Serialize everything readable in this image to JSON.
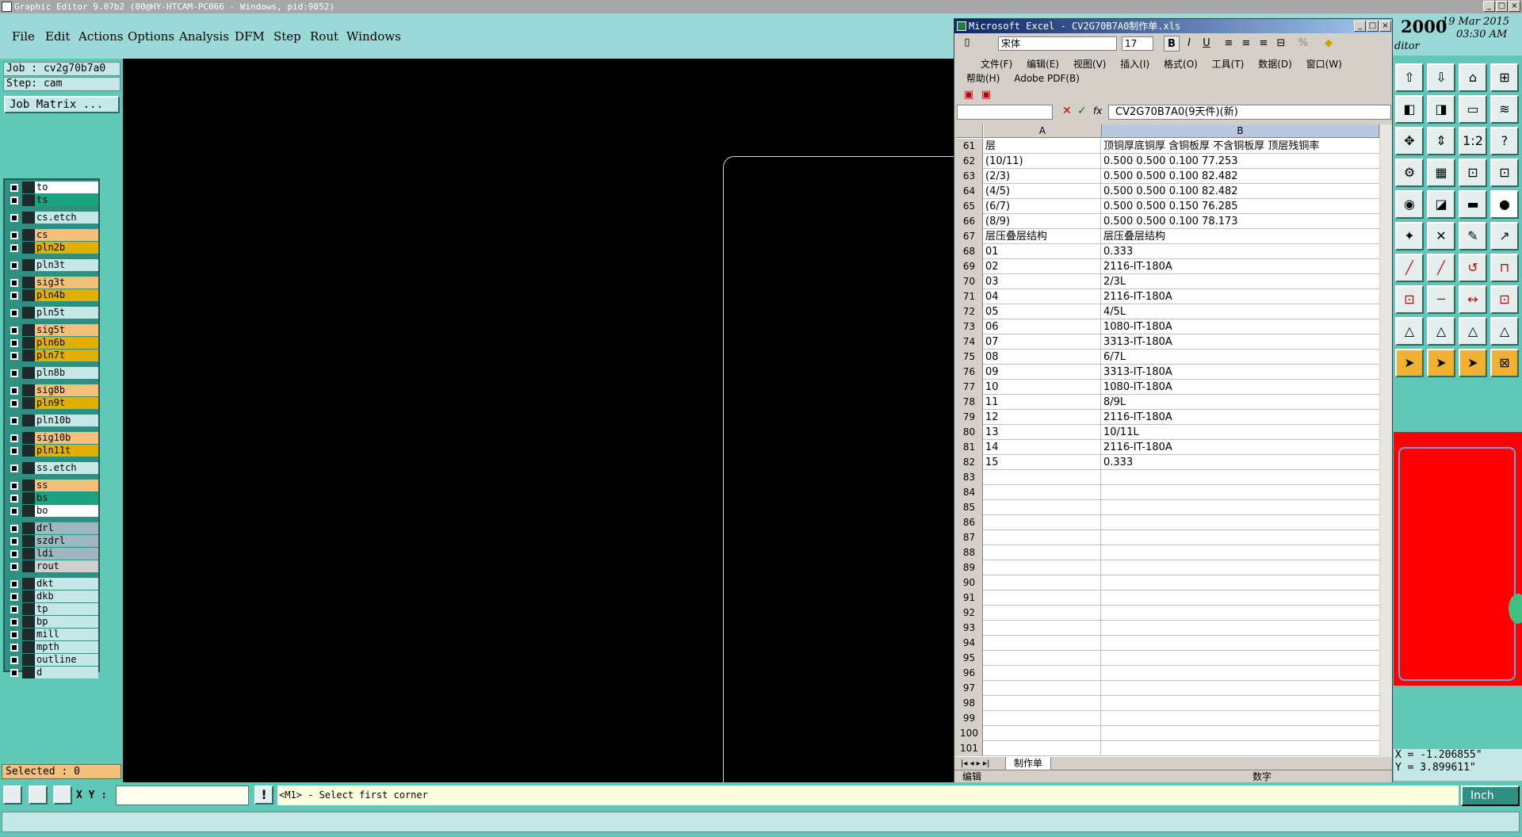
{
  "window": {
    "title": "Graphic Editor 9.07b2 (00@HY-HTCAM-PC066 - Windows, pid:9852)"
  },
  "menu": [
    "File",
    "Edit",
    "Actions",
    "Options",
    "Analysis",
    "DFM",
    "Step",
    "Rout",
    "Windows"
  ],
  "job": {
    "job": "Job : cv2g70b7a0",
    "step": "Step: cam",
    "matrix_button": "Job Matrix ..."
  },
  "layers": [
    {
      "name": "to",
      "color": "#ffffff"
    },
    {
      "name": "ts",
      "color": "#1aa37f"
    },
    {
      "name": "cs.etch",
      "color": "#c4e8e8"
    },
    {
      "name": "cs",
      "color": "#f5c07a"
    },
    {
      "name": "pln2b",
      "color": "#e0b000"
    },
    {
      "name": "pln3t",
      "color": "#c4e8e8"
    },
    {
      "name": "sig3t",
      "color": "#f5c07a"
    },
    {
      "name": "pln4b",
      "color": "#e0b000"
    },
    {
      "name": "pln5t",
      "color": "#c4e8e8"
    },
    {
      "name": "sig5t",
      "color": "#f5c07a"
    },
    {
      "name": "pln6b",
      "color": "#e0b000"
    },
    {
      "name": "pln7t",
      "color": "#e0b000"
    },
    {
      "name": "pln8b",
      "color": "#c4e8e8"
    },
    {
      "name": "sig8b",
      "color": "#f5c07a"
    },
    {
      "name": "pln9t",
      "color": "#e0b000"
    },
    {
      "name": "pln10b",
      "color": "#c4e8e8"
    },
    {
      "name": "sig10b",
      "color": "#f5c07a"
    },
    {
      "name": "pln11t",
      "color": "#e0b000"
    },
    {
      "name": "ss.etch",
      "color": "#c4e8e8"
    },
    {
      "name": "ss",
      "color": "#f5c07a"
    },
    {
      "name": "bs",
      "color": "#1aa37f"
    },
    {
      "name": "bo",
      "color": "#ffffff"
    },
    {
      "name": "drl",
      "color": "#9fb8c0"
    },
    {
      "name": "szdrl",
      "color": "#9fb8c0"
    },
    {
      "name": "ldi",
      "color": "#9fb8c0"
    },
    {
      "name": "rout",
      "color": "#d0d0d0"
    },
    {
      "name": "dkt",
      "color": "#c4e8e8"
    },
    {
      "name": "dkb",
      "color": "#c4e8e8"
    },
    {
      "name": "tp",
      "color": "#c4e8e8"
    },
    {
      "name": "bp",
      "color": "#c4e8e8"
    },
    {
      "name": "mill",
      "color": "#c4e8e8"
    },
    {
      "name": "mpth",
      "color": "#c4e8e8"
    },
    {
      "name": "outline",
      "color": "#c4e8e8"
    },
    {
      "name": "d",
      "color": "#c4e8e8"
    }
  ],
  "selected": "Selected : 0",
  "excel": {
    "title": "Microsoft Excel - CV2G70B7A0制作单.xls",
    "font": "宋体",
    "size": "17",
    "menu": [
      "文件(F)",
      "编辑(E)",
      "视图(V)",
      "插入(I)",
      "格式(O)",
      "工具(T)",
      "数据(D)",
      "窗口(W)"
    ],
    "menu2": [
      "帮助(H)",
      "Adobe PDF(B)"
    ],
    "formula": "CV2G70B7A0(9天件)(新)",
    "col_a": "A",
    "col_b": "B",
    "rows": [
      {
        "n": "61",
        "a": "层",
        "b": "顶铜厚底铜厚 含铜板厚 不含铜板厚 顶层残铜率"
      },
      {
        "n": "62",
        "a": "(10/11)",
        "b": "0.500  0.500          0.100      77.253"
      },
      {
        "n": "63",
        "a": "(2/3)",
        "b": "0.500  0.500          0.100      82.482"
      },
      {
        "n": "64",
        "a": "(4/5)",
        "b": "0.500  0.500          0.100      82.482"
      },
      {
        "n": "65",
        "a": "(6/7)",
        "b": "0.500  0.500          0.150      76.285"
      },
      {
        "n": "66",
        "a": "(8/9)",
        "b": "0.500  0.500          0.100      78.173"
      },
      {
        "n": "67",
        "a": "层压叠层结构",
        "b": "层压叠层结构"
      },
      {
        "n": "68",
        "a": "01",
        "b": "0.333"
      },
      {
        "n": "69",
        "a": "02",
        "b": "2116-IT-180A"
      },
      {
        "n": "70",
        "a": "03",
        "b": "2/3L"
      },
      {
        "n": "71",
        "a": "04",
        "b": "2116-IT-180A"
      },
      {
        "n": "72",
        "a": "05",
        "b": "4/5L"
      },
      {
        "n": "73",
        "a": "06",
        "b": "1080-IT-180A"
      },
      {
        "n": "74",
        "a": "07",
        "b": "3313-IT-180A"
      },
      {
        "n": "75",
        "a": "08",
        "b": "6/7L"
      },
      {
        "n": "76",
        "a": "09",
        "b": "3313-IT-180A"
      },
      {
        "n": "77",
        "a": "10",
        "b": "1080-IT-180A"
      },
      {
        "n": "78",
        "a": "11",
        "b": "8/9L"
      },
      {
        "n": "79",
        "a": "12",
        "b": "2116-IT-180A"
      },
      {
        "n": "80",
        "a": "13",
        "b": "10/11L"
      },
      {
        "n": "81",
        "a": "14",
        "b": "2116-IT-180A"
      },
      {
        "n": "82",
        "a": "15",
        "b": "0.333"
      },
      {
        "n": "83",
        "a": "",
        "b": ""
      },
      {
        "n": "84",
        "a": "",
        "b": ""
      },
      {
        "n": "85",
        "a": "",
        "b": ""
      },
      {
        "n": "86",
        "a": "",
        "b": ""
      },
      {
        "n": "87",
        "a": "",
        "b": ""
      },
      {
        "n": "88",
        "a": "",
        "b": ""
      },
      {
        "n": "89",
        "a": "",
        "b": ""
      },
      {
        "n": "90",
        "a": "",
        "b": ""
      },
      {
        "n": "91",
        "a": "",
        "b": ""
      },
      {
        "n": "92",
        "a": "",
        "b": ""
      },
      {
        "n": "93",
        "a": "",
        "b": ""
      },
      {
        "n": "94",
        "a": "",
        "b": ""
      },
      {
        "n": "95",
        "a": "",
        "b": ""
      },
      {
        "n": "96",
        "a": "",
        "b": ""
      },
      {
        "n": "97",
        "a": "",
        "b": ""
      },
      {
        "n": "98",
        "a": "",
        "b": ""
      },
      {
        "n": "99",
        "a": "",
        "b": ""
      },
      {
        "n": "100",
        "a": "",
        "b": ""
      },
      {
        "n": "101",
        "a": "",
        "b": ""
      }
    ],
    "sheet_tab": "制作单",
    "status_left": "编辑",
    "status_right": "数字"
  },
  "clock": {
    "year": "2000",
    "date": "19 Mar 2015",
    "time": "03:30 AM",
    "label": "ditor"
  },
  "coords": {
    "x": "X = -1.206855\"",
    "y": "Y = 3.899611\""
  },
  "bottom": {
    "xy_label": "X Y :",
    "message": "<M1> - Select first corner",
    "unit": "Inch"
  }
}
